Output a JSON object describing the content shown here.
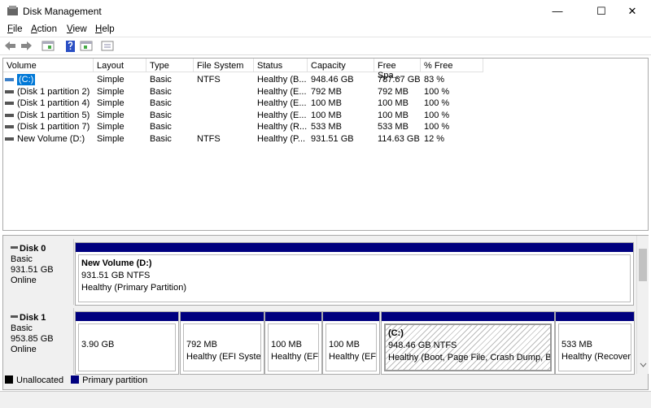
{
  "window": {
    "title": "Disk Management",
    "min": "—",
    "max": "☐",
    "close": "✕"
  },
  "menu": [
    {
      "label": "File",
      "u": "F",
      "rest": "ile"
    },
    {
      "label": "Action",
      "u": "A",
      "rest": "ction"
    },
    {
      "label": "View",
      "u": "V",
      "rest": "iew"
    },
    {
      "label": "Help",
      "u": "H",
      "rest": "elp"
    }
  ],
  "columns": [
    "Volume",
    "Layout",
    "Type",
    "File System",
    "Status",
    "Capacity",
    "Free Spa...",
    "% Free"
  ],
  "rows": [
    [
      "(C:)",
      "Simple",
      "Basic",
      "NTFS",
      "Healthy (B...",
      "948.46 GB",
      "787.67 GB",
      "83 %"
    ],
    [
      "(Disk 1 partition 2)",
      "Simple",
      "Basic",
      "",
      "Healthy (E...",
      "792 MB",
      "792 MB",
      "100 %"
    ],
    [
      "(Disk 1 partition 4)",
      "Simple",
      "Basic",
      "",
      "Healthy (E...",
      "100 MB",
      "100 MB",
      "100 %"
    ],
    [
      "(Disk 1 partition 5)",
      "Simple",
      "Basic",
      "",
      "Healthy (E...",
      "100 MB",
      "100 MB",
      "100 %"
    ],
    [
      "(Disk 1 partition 7)",
      "Simple",
      "Basic",
      "",
      "Healthy (R...",
      "533 MB",
      "533 MB",
      "100 %"
    ],
    [
      "New Volume (D:)",
      "Simple",
      "Basic",
      "NTFS",
      "Healthy (P...",
      "931.51 GB",
      "114.63 GB",
      "12 %"
    ]
  ],
  "disks": [
    {
      "name": "Disk 0",
      "type": "Basic",
      "size": "931.51 GB",
      "state": "Online",
      "partitions": [
        {
          "name": "New Volume  (D:)",
          "size": "931.51 GB NTFS",
          "status": "Healthy (Primary Partition)"
        }
      ]
    },
    {
      "name": "Disk 1",
      "type": "Basic",
      "size": "953.85 GB",
      "state": "Online",
      "partitions": [
        {
          "name": "",
          "size": "3.90 GB",
          "status": ""
        },
        {
          "name": "",
          "size": "792 MB",
          "status": "Healthy (EFI System"
        },
        {
          "name": "",
          "size": "100 MB",
          "status": "Healthy (EFI"
        },
        {
          "name": "",
          "size": "100 MB",
          "status": "Healthy (EFI"
        },
        {
          "name": "(C:)",
          "size": "948.46 GB NTFS",
          "status": "Healthy (Boot, Page File, Crash Dump, Basic"
        },
        {
          "name": "",
          "size": "533 MB",
          "status": "Healthy (Recovery I"
        }
      ]
    }
  ],
  "legend": [
    {
      "label": "Unallocated",
      "color": "#000000"
    },
    {
      "label": "Primary partition",
      "color": "#00007f"
    }
  ],
  "colors": {
    "primary": "#00007f",
    "selection": "#0078d7"
  }
}
